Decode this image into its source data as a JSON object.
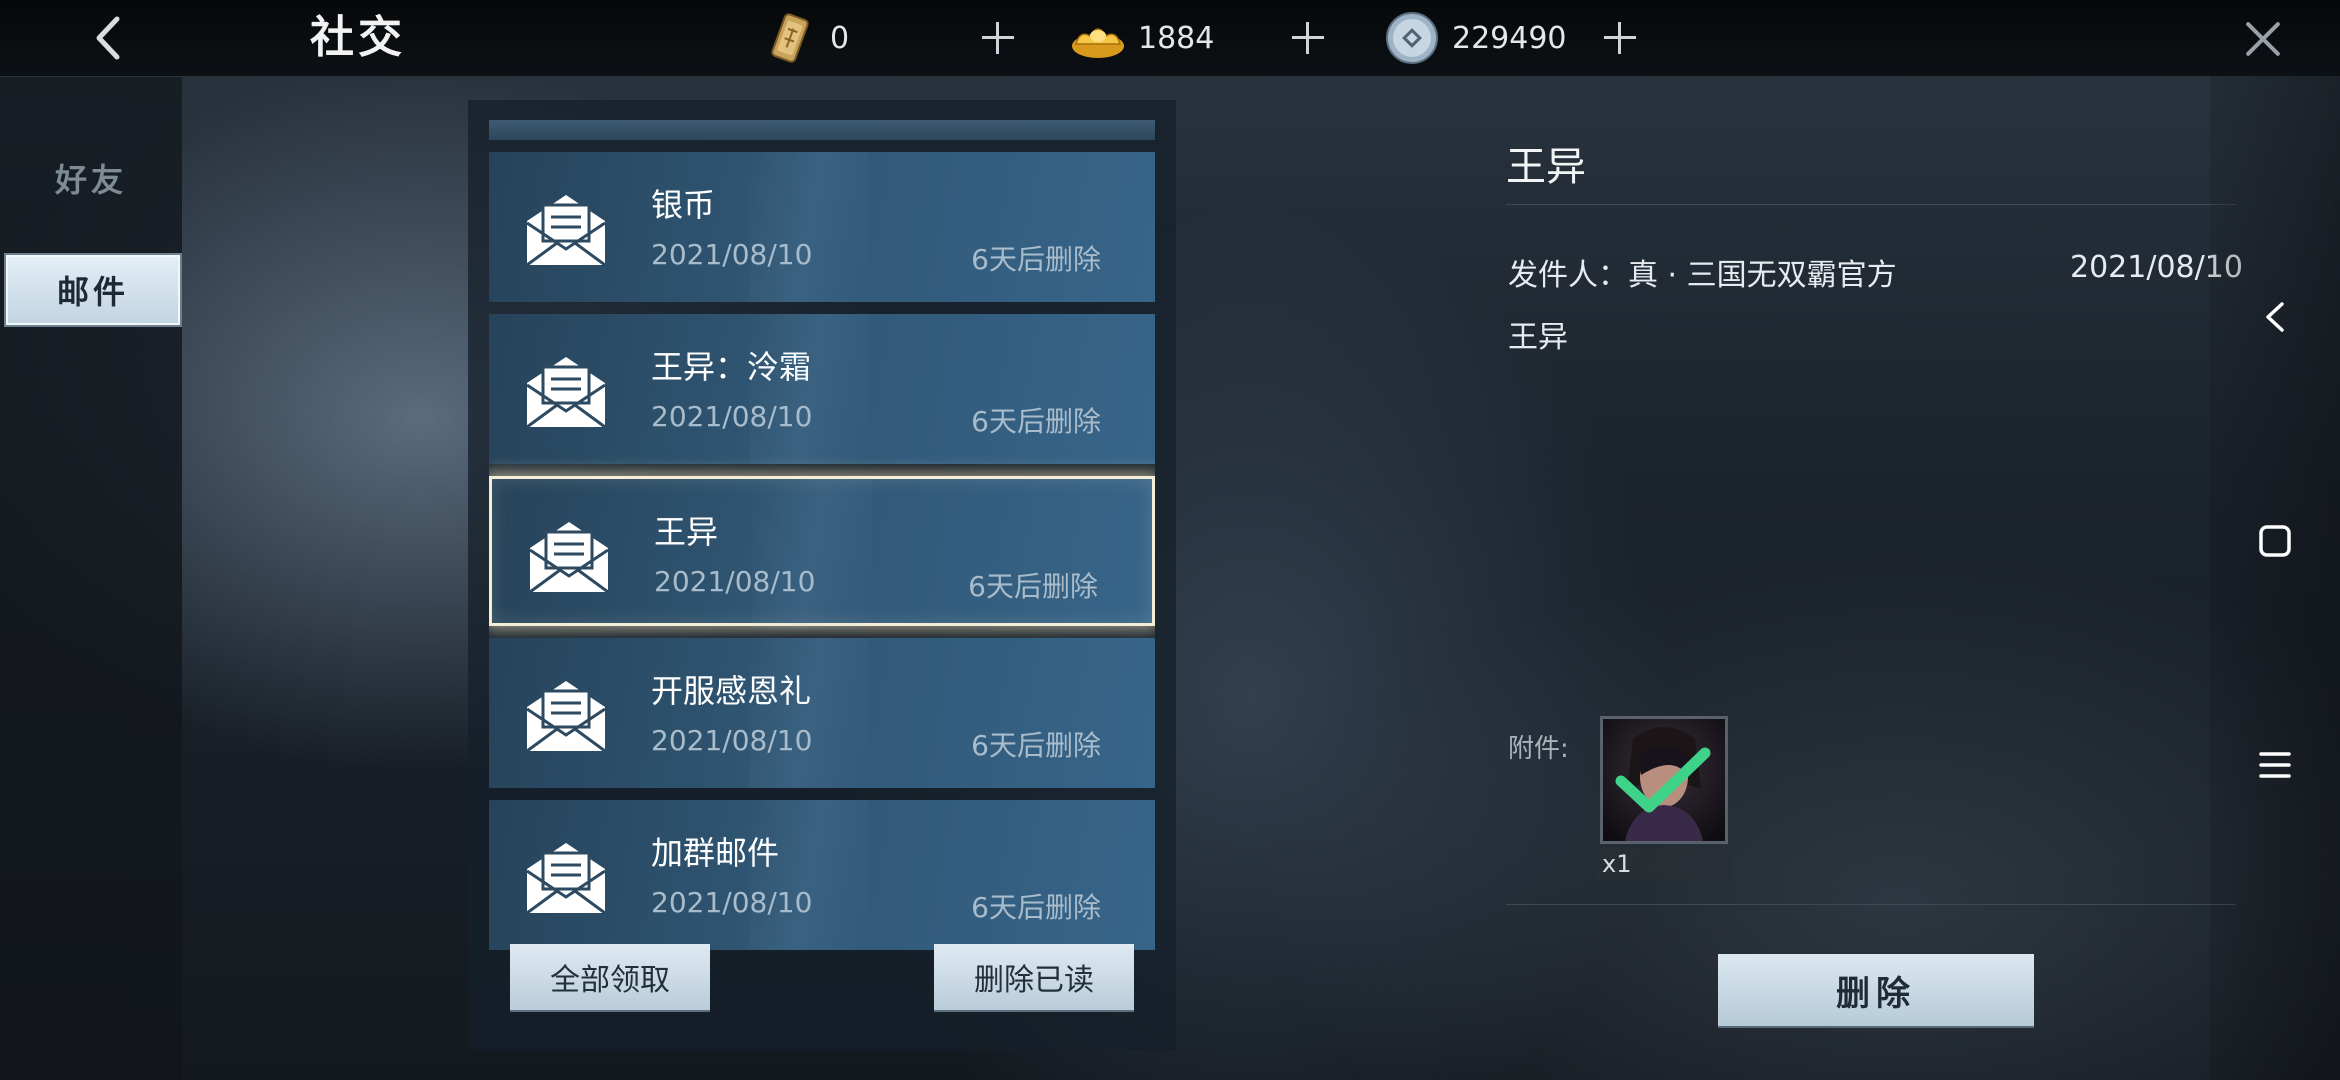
{
  "header": {
    "title": "社交",
    "currencies": [
      {
        "icon": "token-icon",
        "value": "0"
      },
      {
        "icon": "gold-ingot-icon",
        "value": "1884"
      },
      {
        "icon": "silver-coin-icon",
        "value": "229490"
      }
    ]
  },
  "sidebar": {
    "tabs": [
      {
        "label": "好友",
        "active": false
      },
      {
        "label": "邮件",
        "active": true
      }
    ]
  },
  "mail_list": {
    "items": [
      {
        "title": "银币",
        "date": "2021/08/10",
        "expire": "6天后删除",
        "selected": false
      },
      {
        "title": "王异：泠霜",
        "date": "2021/08/10",
        "expire": "6天后删除",
        "selected": false
      },
      {
        "title": "王异",
        "date": "2021/08/10",
        "expire": "6天后删除",
        "selected": true
      },
      {
        "title": "开服感恩礼",
        "date": "2021/08/10",
        "expire": "6天后删除",
        "selected": false
      },
      {
        "title": "加群邮件",
        "date": "2021/08/10",
        "expire": "6天后删除",
        "selected": false
      }
    ],
    "claim_all_label": "全部领取",
    "delete_read_label": "删除已读"
  },
  "detail": {
    "title": "王异",
    "sender": "发件人：真 · 三国无双霸官方",
    "date": "2021/08/10",
    "body": "王异",
    "attachment_label": "附件:",
    "attachment": {
      "icon": "character-portrait-icon",
      "count": "x1",
      "claimed": true
    },
    "delete_label": "删除"
  },
  "colors": {
    "accent": "#37658a",
    "selected_border": "#f6edd6",
    "claimed_check": "#3fd38a"
  }
}
